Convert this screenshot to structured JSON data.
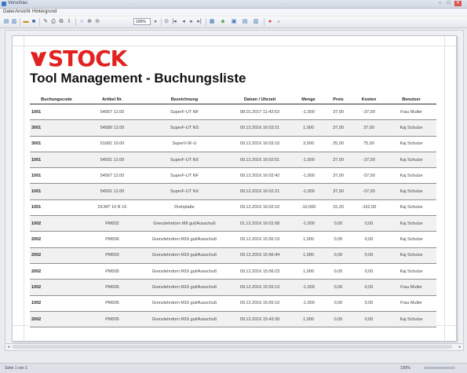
{
  "window": {
    "title": "Vorschau",
    "controls": [
      "–",
      "□",
      "✕"
    ]
  },
  "menu": [
    "Datei",
    "Ansicht",
    "Hintergrund"
  ],
  "toolbar": {
    "zoom": "100%",
    "icons": [
      "open-icon",
      "save-icon",
      "print-icon",
      "export-icon",
      "search-icon",
      "zoom-in-icon",
      "zoom-out-icon",
      "first-page-icon",
      "prev-page-icon",
      "next-page-icon",
      "last-page-icon",
      "page-layout-icon",
      "background-color-icon",
      "watermark-icon",
      "stop-icon"
    ]
  },
  "report": {
    "logo": "STOCK",
    "title": "Tool Management - Buchungsliste",
    "columns": [
      "Buchungscode",
      "Artikel Nr.",
      "Bezeichnung",
      "Datum / Uhrzeit",
      "Menge",
      "Preis",
      "Kosten",
      "Benutzer"
    ],
    "rows": [
      [
        "1001",
        "54567 12.00",
        "SuperF-UT NF",
        "08.01.2017 11:42:53",
        "-1,000",
        "37,00",
        "-37,00",
        "Frau Muller"
      ],
      [
        "3001",
        "54580 12.00",
        "SuperF-UT NS",
        "09.12.2016 16:03:21",
        "1,000",
        "37,00",
        "37,00",
        "Kaj Schulze"
      ],
      [
        "3001",
        "51681 10.00",
        "SuperV-IK-U",
        "09.12.2016 16:03:10",
        "3,000",
        "25,00",
        "75,00",
        "Kaj Schulze"
      ],
      [
        "1001",
        "54591 12.00",
        "SuperF-UT NX",
        "09.12.2016 16:02:51",
        "-1,000",
        "37,00",
        "-37,00",
        "Kaj Schulze"
      ],
      [
        "1001",
        "54567 12.00",
        "SuperF-UT NF",
        "09.12.2016 16:02:42",
        "-1,000",
        "37,00",
        "-37,00",
        "Kaj Schulze"
      ],
      [
        "1001",
        "54591 12.00",
        "SuperF-UT NX",
        "09.12.2016 16:02:21",
        "-1,000",
        "37,00",
        "-37,00",
        "Kaj Schulze"
      ],
      [
        "1001",
        "DCMT 10 R 16",
        "Drehplatte",
        "09.12.2016 16:02:10",
        "-10,000",
        "15,20",
        "-152,00",
        "Kaj Schulze"
      ],
      [
        "1002",
        "PM002",
        "Grenzlehrdorn M8 gut/Ausschuß",
        "01.12.2016 16:01:08",
        "-1,000",
        "0,00",
        "0,00",
        "Kaj Schulze"
      ],
      [
        "2002",
        "PM006",
        "Grenzlehrdorn M16 gut/Ausschuß",
        "09.12.2016 15:56:19",
        "1,000",
        "0,00",
        "0,00",
        "Kaj Schulze"
      ],
      [
        "2002",
        "PM003",
        "Grenzlehrdorn M10 gut/Ausschuß",
        "09.12.2016 15:56:44",
        "1,000",
        "0,00",
        "0,00",
        "Kaj Schulze"
      ],
      [
        "2002",
        "PM005",
        "Grenzlehrdorn M16 gut/Ausschuß",
        "09.12.2016 15:56:23",
        "1,000",
        "0,00",
        "0,00",
        "Kaj Schulze"
      ],
      [
        "1002",
        "PM005",
        "Grenzlehrdorn M16 gut/Ausschuß",
        "09.12.2016 15:55:13",
        "-1,000",
        "0,00",
        "0,00",
        "Frau Muller"
      ],
      [
        "1002",
        "PM005",
        "Grenzlehrdorn M16 gut/Ausschuß",
        "09.12.2016 15:55:10",
        "-1,000",
        "0,00",
        "0,00",
        "Frau Muller"
      ],
      [
        "2002",
        "PM005",
        "Grenzlehrdorn M16 gut/Ausschuß",
        "09.12.2016 15:43:39",
        "1,000",
        "0,00",
        "0,00",
        "Kaj Schulze"
      ]
    ]
  },
  "statusbar": {
    "page": "Seite 1 von 1",
    "zoom": "100%"
  },
  "colors": {
    "brand": "#e2221f",
    "rule": "#333333",
    "alt_row": "#f1f1f1"
  }
}
